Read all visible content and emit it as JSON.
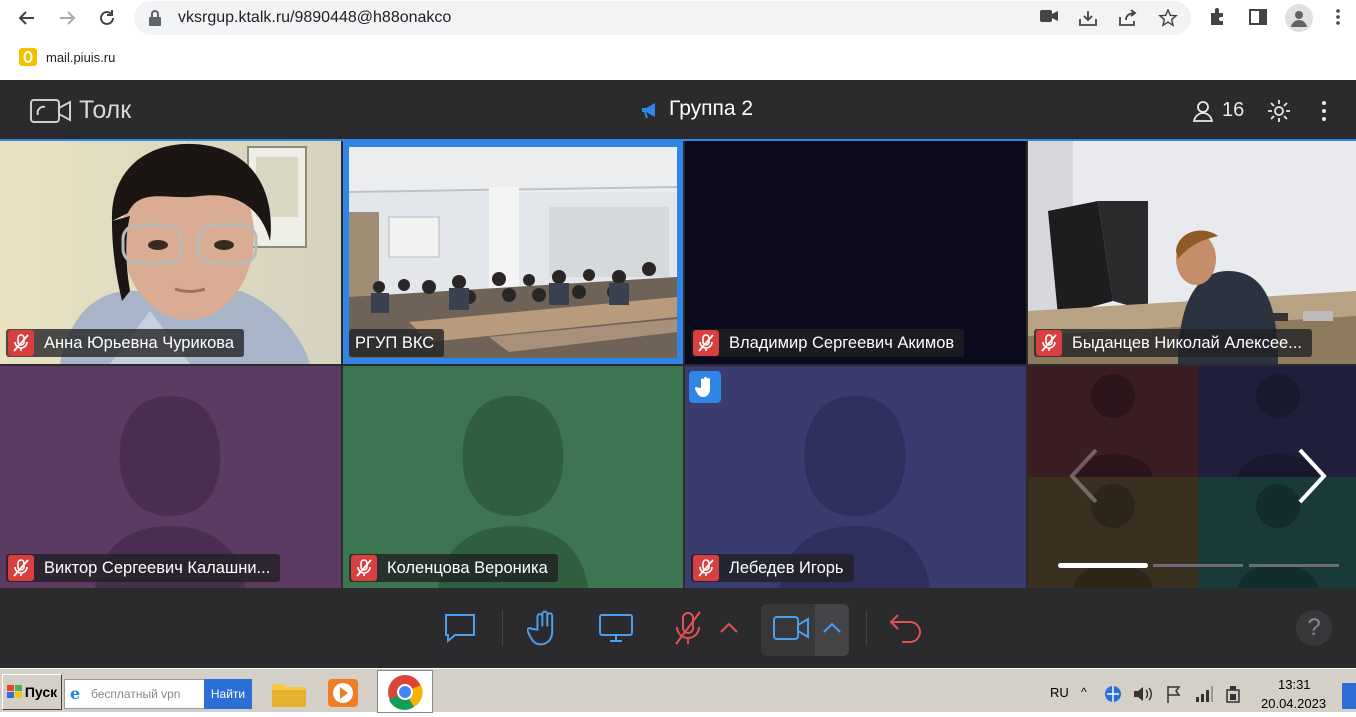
{
  "browser": {
    "url": "vksrgup.ktalk.ru/9890448@h88onakco",
    "bookmark": "mail.piuis.ru"
  },
  "app": {
    "logo": "Толк",
    "room_title": "Группа 2",
    "participants_count": "16"
  },
  "participants": [
    {
      "name": "Анна Юрьевна Чурикова",
      "muted": true
    },
    {
      "name": "РГУП ВКС",
      "muted": false,
      "active_speaker": true
    },
    {
      "name": "Владимир Сергеевич Акимов",
      "muted": true
    },
    {
      "name": "Быданцев Николай Алексее...",
      "muted": true
    },
    {
      "name": "Виктор Сергеевич Калашни...",
      "muted": true
    },
    {
      "name": "Коленцова Вероника",
      "muted": true
    },
    {
      "name": "Лебедев Игорь",
      "muted": true,
      "hand_raised": true
    }
  ],
  "pager": {
    "pages": 3,
    "current": 1
  },
  "controls": [
    "chat-button",
    "raise-hand-button",
    "screen-share-button",
    "microphone-button",
    "camera-button",
    "leave-button",
    "help-button"
  ],
  "help_label": "?",
  "taskbar": {
    "start_label": "Пуск",
    "search_placeholder": "бесплатный vpn",
    "search_button": "Найти",
    "lang": "RU",
    "time": "13:31",
    "date": "20.04.2023"
  },
  "colors": {
    "accent_blue": "#2f86e6",
    "muted_red": "#d84040",
    "tile_purple": "#5c3b63",
    "tile_green": "#3d7550",
    "tile_indigo": "#3a3b6e",
    "tile_dark": "#0b0a1d"
  }
}
